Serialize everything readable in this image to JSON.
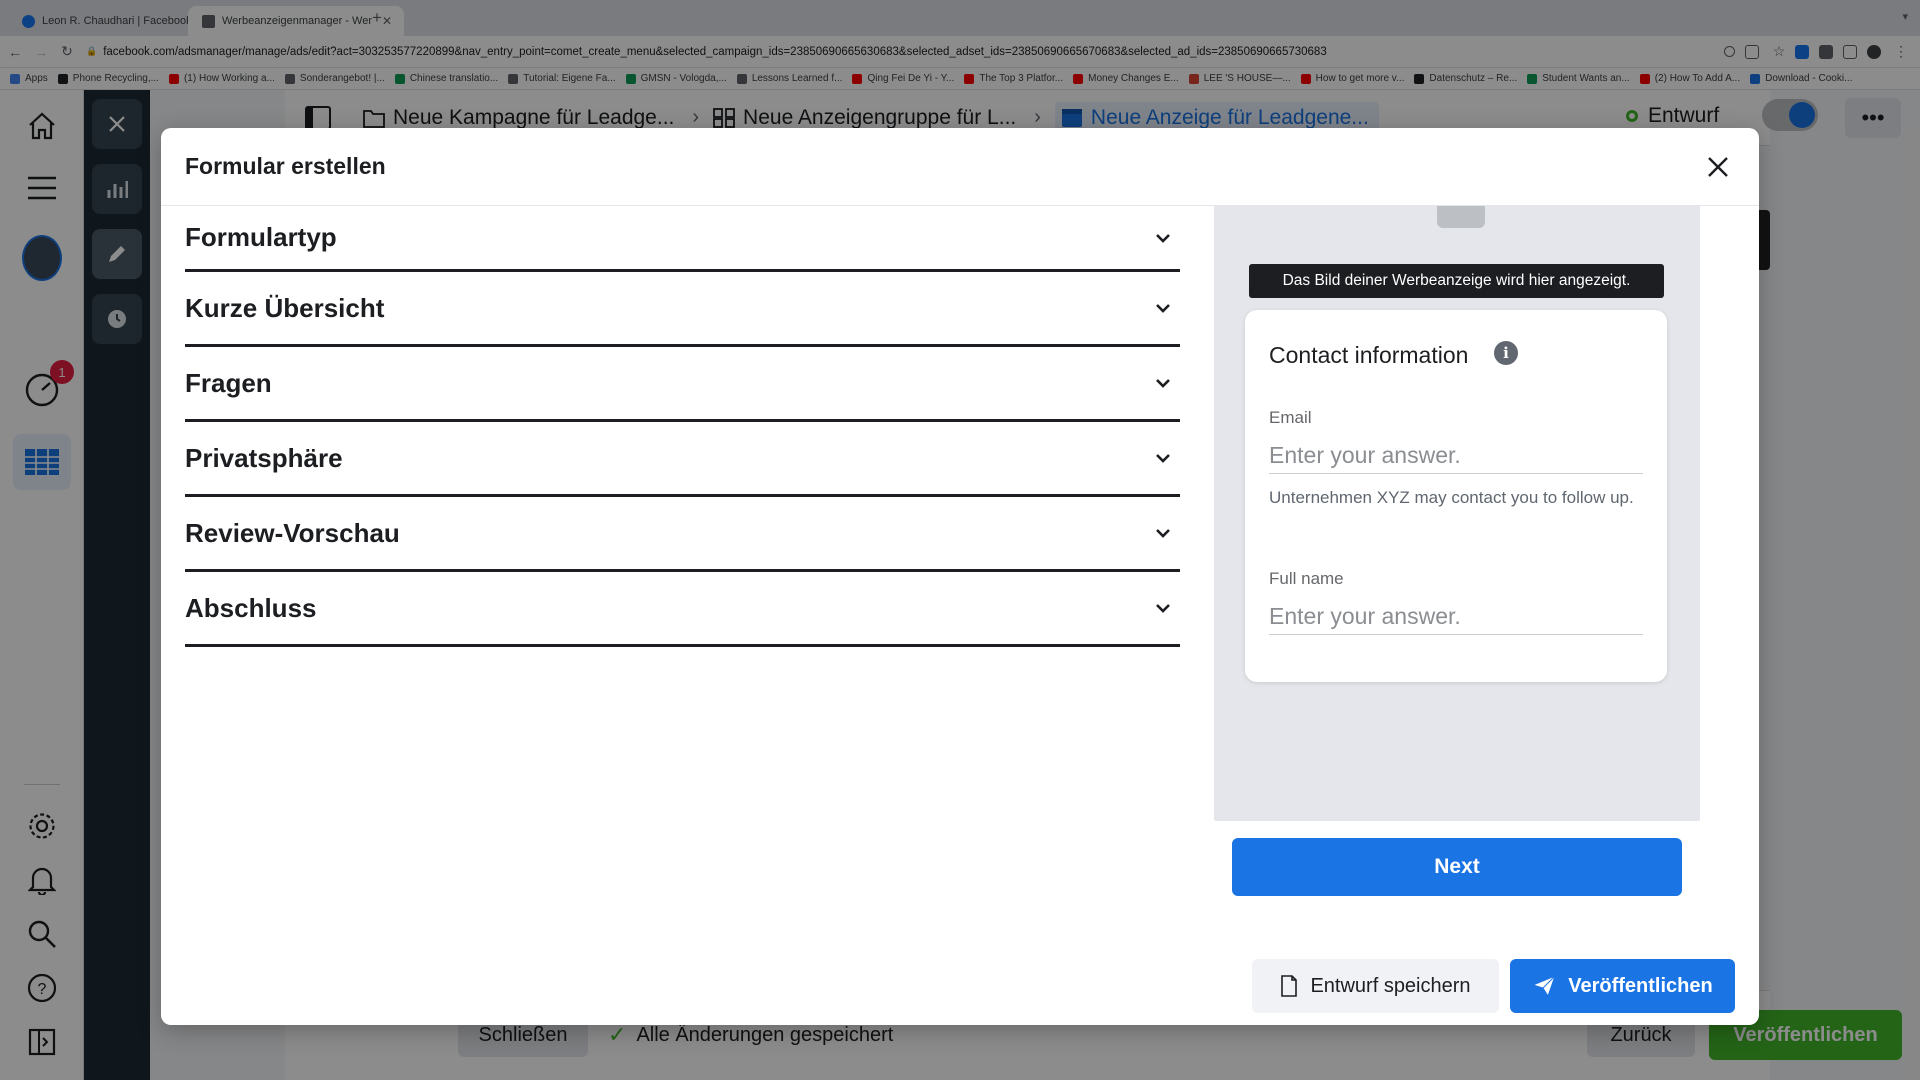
{
  "browser": {
    "tabs": [
      {
        "title": "Leon R. Chaudhari | Facebook",
        "favicon_color": "#1877f2"
      },
      {
        "title": "Werbeanzeigenmanager - Wer",
        "favicon_color": "#5f6368"
      }
    ],
    "url": "facebook.com/adsmanager/manage/ads/edit?act=303253577220899&nav_entry_point=comet_create_menu&selected_campaign_ids=23850690665630683&selected_adset_ids=23850690665670683&selected_ad_ids=23850690665730683",
    "bookmarks": [
      {
        "label": "Apps",
        "color": "#4285f4"
      },
      {
        "label": "Phone Recycling,...",
        "color": "#202124"
      },
      {
        "label": "(1) How Working a...",
        "color": "#ff0000"
      },
      {
        "label": "Sonderangebot! |...",
        "color": "#5f6368"
      },
      {
        "label": "Chinese translatio...",
        "color": "#0f9d58"
      },
      {
        "label": "Tutorial: Eigene Fa...",
        "color": "#5f6368"
      },
      {
        "label": "GMSN - Vologda,...",
        "color": "#0f9d58"
      },
      {
        "label": "Lessons Learned f...",
        "color": "#5f6368"
      },
      {
        "label": "Qing Fei De Yi - Y...",
        "color": "#ff0000"
      },
      {
        "label": "The Top 3 Platfor...",
        "color": "#ff0000"
      },
      {
        "label": "Money Changes E...",
        "color": "#ff0000"
      },
      {
        "label": "LEE 'S HOUSE—...",
        "color": "#db4437"
      },
      {
        "label": "How to get more v...",
        "color": "#ff0000"
      },
      {
        "label": "Datenschutz – Re...",
        "color": "#202124"
      },
      {
        "label": "Student Wants an...",
        "color": "#0f9d58"
      },
      {
        "label": "(2) How To Add A...",
        "color": "#ff0000"
      },
      {
        "label": "Download - Cooki...",
        "color": "#1a73e8"
      }
    ]
  },
  "app": {
    "breadcrumbs": [
      {
        "label": "Neue Kampagne für Leadge...",
        "icon": "folder-icon"
      },
      {
        "label": "Neue Anzeigengruppe für L...",
        "icon": "grid-icon"
      },
      {
        "label": "Neue Anzeige für Leadgene...",
        "icon": "ad-icon"
      }
    ],
    "status": "Entwurf",
    "notification_count": "1",
    "footer": {
      "close_label": "Schließen",
      "saved_label": "Alle Änderungen gespeichert",
      "back_label": "Zurück",
      "publish_label": "Veröffentlichen"
    }
  },
  "dialog": {
    "title": "Formular erstellen",
    "sections": [
      {
        "title": "Formulartyp"
      },
      {
        "title": "Kurze Übersicht"
      },
      {
        "title": "Fragen"
      },
      {
        "title": "Privatsphäre"
      },
      {
        "title": "Review-Vorschau"
      },
      {
        "title": "Abschluss"
      }
    ],
    "preview": {
      "image_caption": "Das Bild deiner Werbeanzeige wird hier angezeigt.",
      "card_title": "Contact information",
      "fields": [
        {
          "label": "Email",
          "placeholder": "Enter your answer."
        },
        {
          "label": "Full name",
          "placeholder": "Enter your answer."
        }
      ],
      "email_note": "Unternehmen XYZ may contact you to follow up.",
      "next_label": "Next"
    },
    "save_draft_label": "Entwurf speichern",
    "publish_label": "Veröffentlichen"
  },
  "colors": {
    "accent": "#1b74e4",
    "publish_green": "#42b72a",
    "tool_rail": "#1c2b33"
  }
}
